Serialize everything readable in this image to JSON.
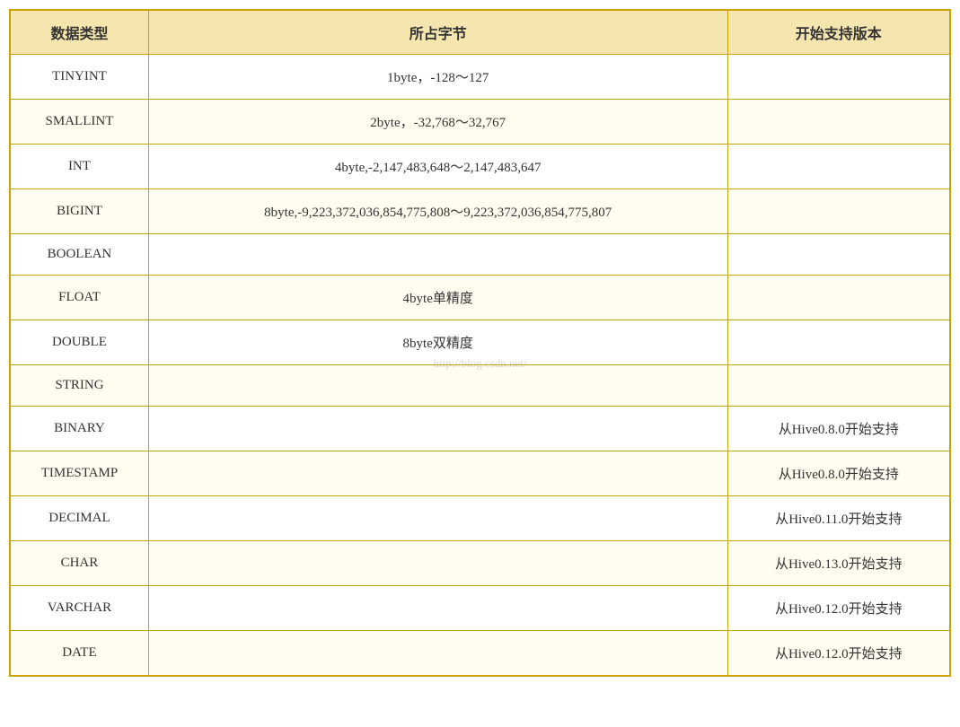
{
  "table": {
    "headers": [
      "数据类型",
      "所占字节",
      "开始支持版本"
    ],
    "rows": [
      {
        "type": "TINYINT",
        "bytes": "1byte，-128～127",
        "version": ""
      },
      {
        "type": "SMALLINT",
        "bytes": "2byte，-32,768～32,767",
        "version": ""
      },
      {
        "type": "INT",
        "bytes": "4byte,-2,147,483,648～2,147,483,647",
        "version": ""
      },
      {
        "type": "BIGINT",
        "bytes": "8byte,-9,223,372,036,854,775,808～9,223,372,036,854,775,807",
        "version": ""
      },
      {
        "type": "BOOLEAN",
        "bytes": "",
        "version": ""
      },
      {
        "type": "FLOAT",
        "bytes": "4byte单精度",
        "version": ""
      },
      {
        "type": "DOUBLE",
        "bytes": "8byte双精度",
        "version": ""
      },
      {
        "type": "STRING",
        "bytes": "",
        "version": ""
      },
      {
        "type": "BINARY",
        "bytes": "",
        "version": "从Hive0.8.0开始支持"
      },
      {
        "type": "TIMESTAMP",
        "bytes": "",
        "version": "从Hive0.8.0开始支持"
      },
      {
        "type": "DECIMAL",
        "bytes": "",
        "version": "从Hive0.11.0开始支持"
      },
      {
        "type": "CHAR",
        "bytes": "",
        "version": "从Hive0.13.0开始支持"
      },
      {
        "type": "VARCHAR",
        "bytes": "",
        "version": "从Hive0.12.0开始支持"
      },
      {
        "type": "DATE",
        "bytes": "",
        "version": "从Hive0.12.0开始支持"
      }
    ]
  },
  "watermark": "http://blog.csdn.net/"
}
